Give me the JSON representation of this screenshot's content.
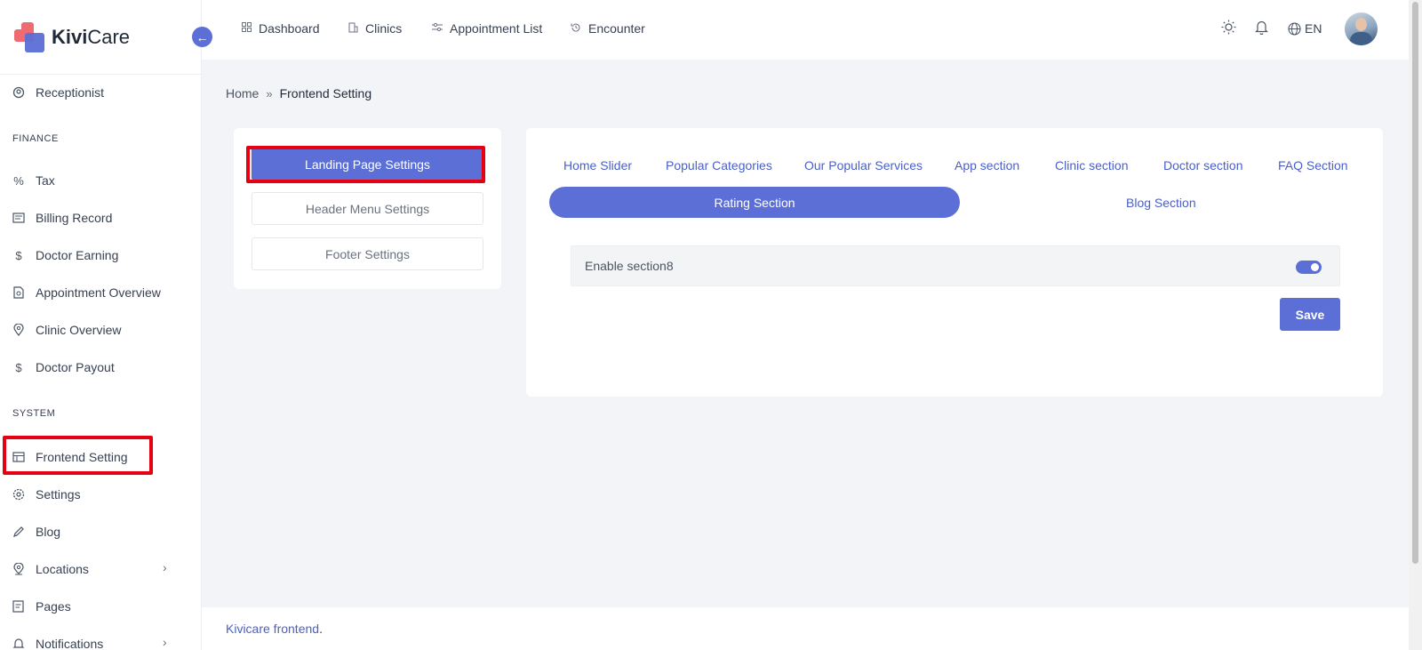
{
  "brand": {
    "name_bold": "Kivi",
    "name_rest": "Care"
  },
  "sidebar": {
    "items": [
      {
        "label": "Receptionist",
        "icon": "receptionist-icon"
      },
      {
        "section": "FINANCE"
      },
      {
        "label": "Tax",
        "icon": "percent-icon"
      },
      {
        "label": "Billing Record",
        "icon": "billing-icon"
      },
      {
        "label": "Doctor Earning",
        "icon": "dollar-icon"
      },
      {
        "label": "Appointment Overview",
        "icon": "document-icon"
      },
      {
        "label": "Clinic Overview",
        "icon": "location-pin-icon"
      },
      {
        "label": "Doctor Payout",
        "icon": "dollar-icon"
      },
      {
        "section": "SYSTEM"
      },
      {
        "label": "Frontend Setting",
        "icon": "layout-icon"
      },
      {
        "label": "Settings",
        "icon": "gear-icon"
      },
      {
        "label": "Blog",
        "icon": "pencil-icon"
      },
      {
        "label": "Locations",
        "icon": "location-pin-icon"
      },
      {
        "label": "Pages",
        "icon": "pages-icon"
      },
      {
        "label": "Notifications",
        "icon": "bell-icon"
      }
    ]
  },
  "topbar": {
    "links": [
      {
        "label": "Dashboard",
        "icon": "grid-icon"
      },
      {
        "label": "Clinics",
        "icon": "building-icon"
      },
      {
        "label": "Appointment List",
        "icon": "sliders-icon"
      },
      {
        "label": "Encounter",
        "icon": "history-icon"
      }
    ],
    "language": "EN"
  },
  "breadcrumb": {
    "home": "Home",
    "current": "Frontend Setting"
  },
  "settings_menu": {
    "items": [
      "Landing Page Settings",
      "Header Menu Settings",
      "Footer Settings"
    ],
    "active": "Landing Page Settings"
  },
  "tabs": {
    "row1": [
      "Home Slider",
      "Popular Categories",
      "Our Popular Services",
      "App section",
      "Clinic section",
      "Doctor section",
      "FAQ Section"
    ],
    "active": "Rating Section",
    "row2_other": "Blog Section"
  },
  "section": {
    "label": "Enable section8",
    "enabled": true,
    "save_label": "Save"
  },
  "footer": {
    "link": "Kivicare frontend",
    "suffix": "."
  },
  "colors": {
    "accent": "#5b6fd6",
    "highlight_box": "#e60012"
  }
}
